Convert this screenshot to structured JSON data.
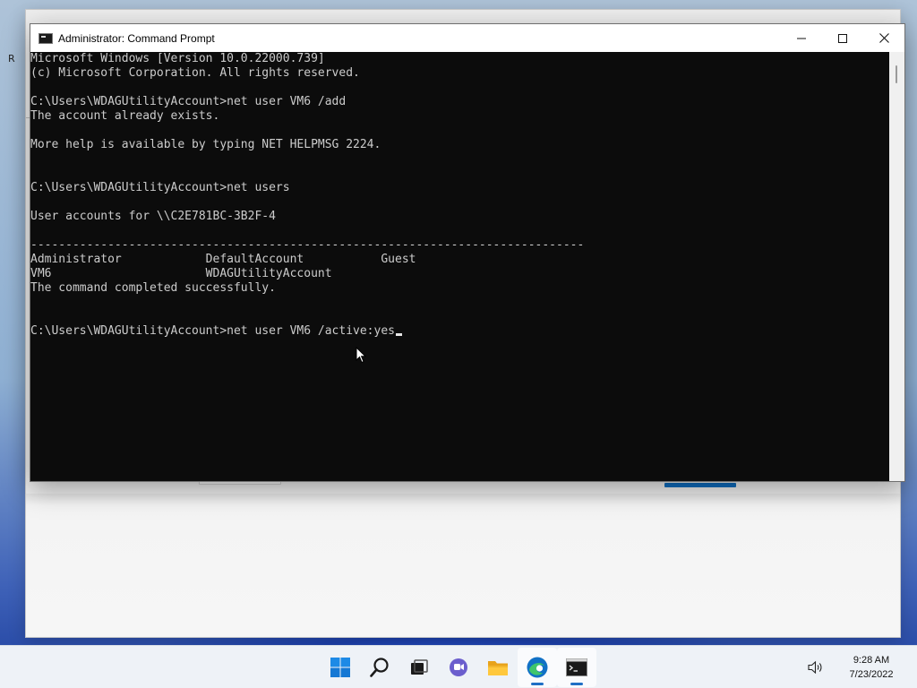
{
  "background_window": {
    "edge_letter": "R"
  },
  "cmd_window": {
    "title": "Administrator: Command Prompt",
    "controls": {
      "minimize": "minimize-icon",
      "maximize": "maximize-icon",
      "close": "close-icon"
    },
    "console_lines": [
      "Microsoft Windows [Version 10.0.22000.739]",
      "(c) Microsoft Corporation. All rights reserved.",
      "",
      "C:\\Users\\WDAGUtilityAccount>net user VM6 /add",
      "The account already exists.",
      "",
      "More help is available by typing NET HELPMSG 2224.",
      "",
      "",
      "C:\\Users\\WDAGUtilityAccount>net users",
      "",
      "User accounts for \\\\C2E781BC-3B2F-4",
      "",
      "-------------------------------------------------------------------------------",
      "Administrator            DefaultAccount           Guest",
      "VM6                      WDAGUtilityAccount",
      "The command completed successfully.",
      "",
      "",
      "C:\\Users\\WDAGUtilityAccount>net user VM6 /active:yes"
    ],
    "colors": {
      "console_bg": "#0c0c0c",
      "console_text": "#cccccc",
      "titlebar_bg": "#ffffff"
    }
  },
  "taskbar": {
    "apps": [
      {
        "name": "start-icon",
        "active": false
      },
      {
        "name": "search-icon",
        "active": false
      },
      {
        "name": "task-view-icon",
        "active": false
      },
      {
        "name": "teams-chat-icon",
        "active": false
      },
      {
        "name": "file-explorer-icon",
        "active": false
      },
      {
        "name": "edge-icon",
        "active": true
      },
      {
        "name": "command-prompt-icon",
        "active": true
      }
    ],
    "tray": {
      "volume_icon": "speaker-icon",
      "time": "9:28 AM",
      "date": "7/23/2022"
    },
    "colors": {
      "accent": "#1f6fc5",
      "bg": "#eef2f7"
    }
  }
}
